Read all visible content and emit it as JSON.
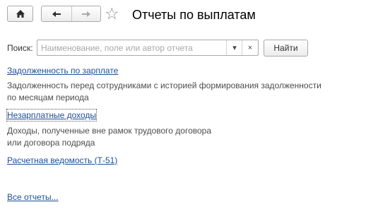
{
  "title": "Отчеты по выплатам",
  "toolbar": {
    "home_icon": "home-icon",
    "back_icon": "arrow-left-icon",
    "forward_icon": "arrow-right-icon",
    "favorite_icon": "star-outline-icon"
  },
  "search": {
    "label": "Поиск:",
    "value": "",
    "placeholder": "Наименование, поле или автор отчета",
    "dropdown_glyph": "▾",
    "clear_glyph": "×",
    "button_label": "Найти"
  },
  "reports": [
    {
      "name": "Задолженность по зарплате",
      "description_lines": [
        "Задолженность перед сотрудниками с историей формирования задолженности",
        "по месяцам периода"
      ]
    },
    {
      "name": "Незарплатные доходы",
      "description_lines": [
        "Доходы, полученные вне рамок трудового договора",
        "или договора подряда"
      ]
    },
    {
      "name": "Расчетная ведомость (Т-51)",
      "description_lines": []
    }
  ],
  "all_reports_link": "Все отчеты...",
  "colors": {
    "link": "#1f4e96",
    "description": "#4d4d4d",
    "title": "#000000"
  }
}
